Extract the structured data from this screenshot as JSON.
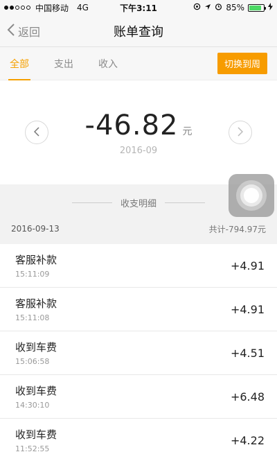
{
  "status_bar": {
    "carrier": "中国移动",
    "network": "4G",
    "time": "下午3:11",
    "battery_percent": "85%",
    "battery_level": 0.85,
    "battery_color": "#4cd964",
    "signal_bars_filled": 2,
    "signal_bars_total": 5,
    "icons": [
      "signal-icon",
      "location-arrow-icon",
      "alarm-icon",
      "bluetooth-icon",
      "charging-icon"
    ]
  },
  "nav": {
    "back_label": "返回",
    "title": "账单查询"
  },
  "tabs": [
    {
      "label": "全部",
      "active": true
    },
    {
      "label": "支出",
      "active": false
    },
    {
      "label": "收入",
      "active": false
    }
  ],
  "switch_button": "切换到周",
  "summary": {
    "amount": "-46.82",
    "unit": "元",
    "month": "2016-09"
  },
  "detail_header": "收支明细",
  "date_group": {
    "date": "2016-09-13",
    "total": "共计-794.97元"
  },
  "transactions": [
    {
      "name": "客服补款",
      "time": "15:11:09",
      "amount": "+4.91"
    },
    {
      "name": "客服补款",
      "time": "15:11:08",
      "amount": "+4.91"
    },
    {
      "name": "收到车费",
      "time": "15:06:58",
      "amount": "+4.51"
    },
    {
      "name": "收到车费",
      "time": "14:30:10",
      "amount": "+6.48"
    },
    {
      "name": "收到车费",
      "time": "11:52:55",
      "amount": "+4.22"
    }
  ],
  "colors": {
    "accent": "#f5a000",
    "button_bg": "#f79c00"
  }
}
